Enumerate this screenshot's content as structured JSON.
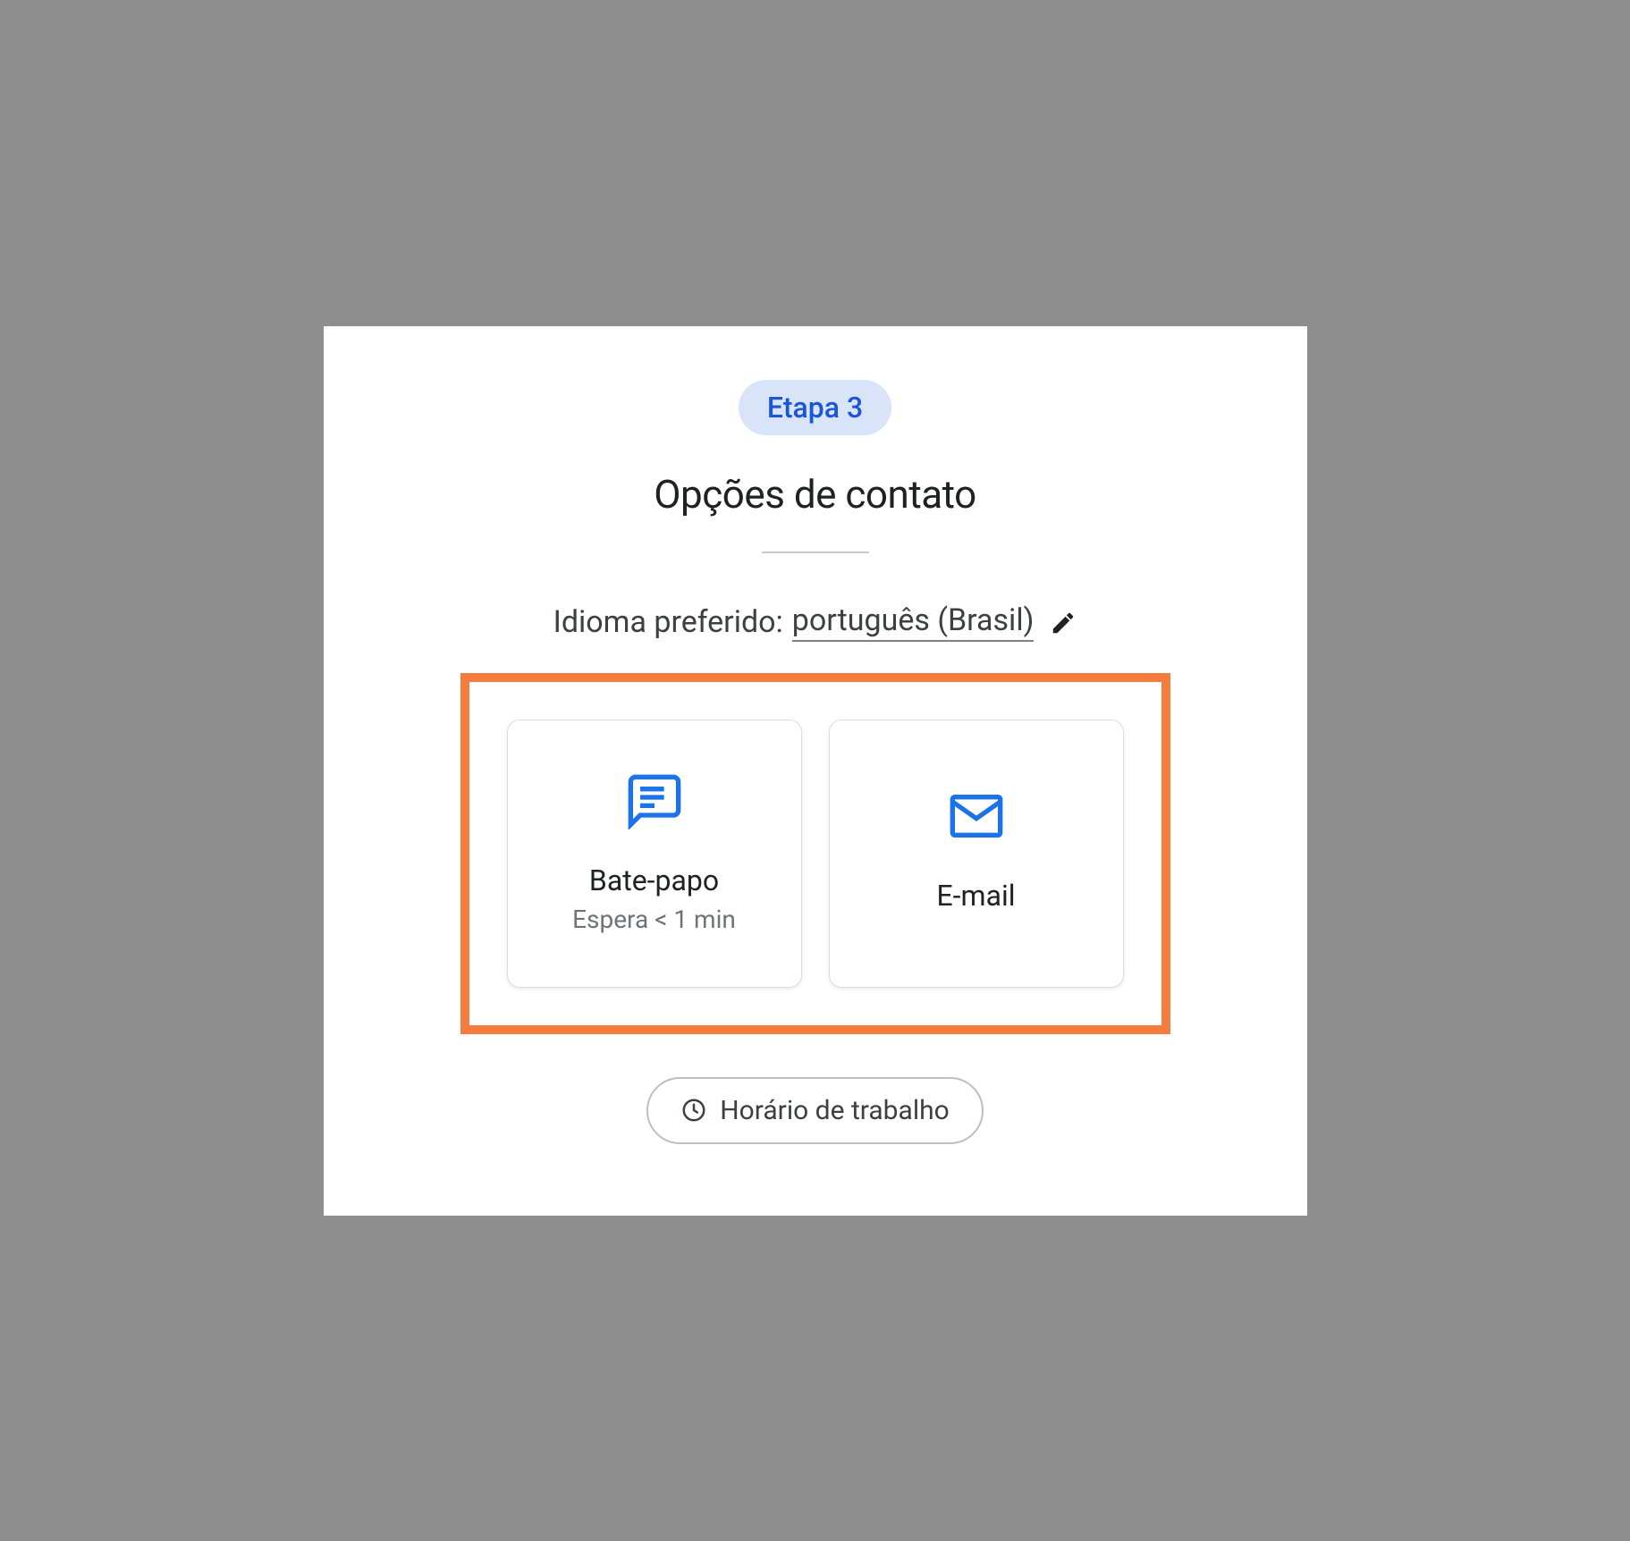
{
  "step": {
    "label": "Etapa 3"
  },
  "title": "Opções de contato",
  "language": {
    "label": "Idioma preferido:",
    "value": "português (Brasil)"
  },
  "options": {
    "chat": {
      "title": "Bate-papo",
      "subtitle": "Espera < 1 min"
    },
    "email": {
      "title": "E-mail"
    }
  },
  "hours_button": "Horário de trabalho",
  "colors": {
    "accent_blue": "#1a73e8",
    "highlight_orange": "#f47c3c",
    "badge_bg": "#d9e4f9",
    "badge_text": "#1a56d6"
  }
}
